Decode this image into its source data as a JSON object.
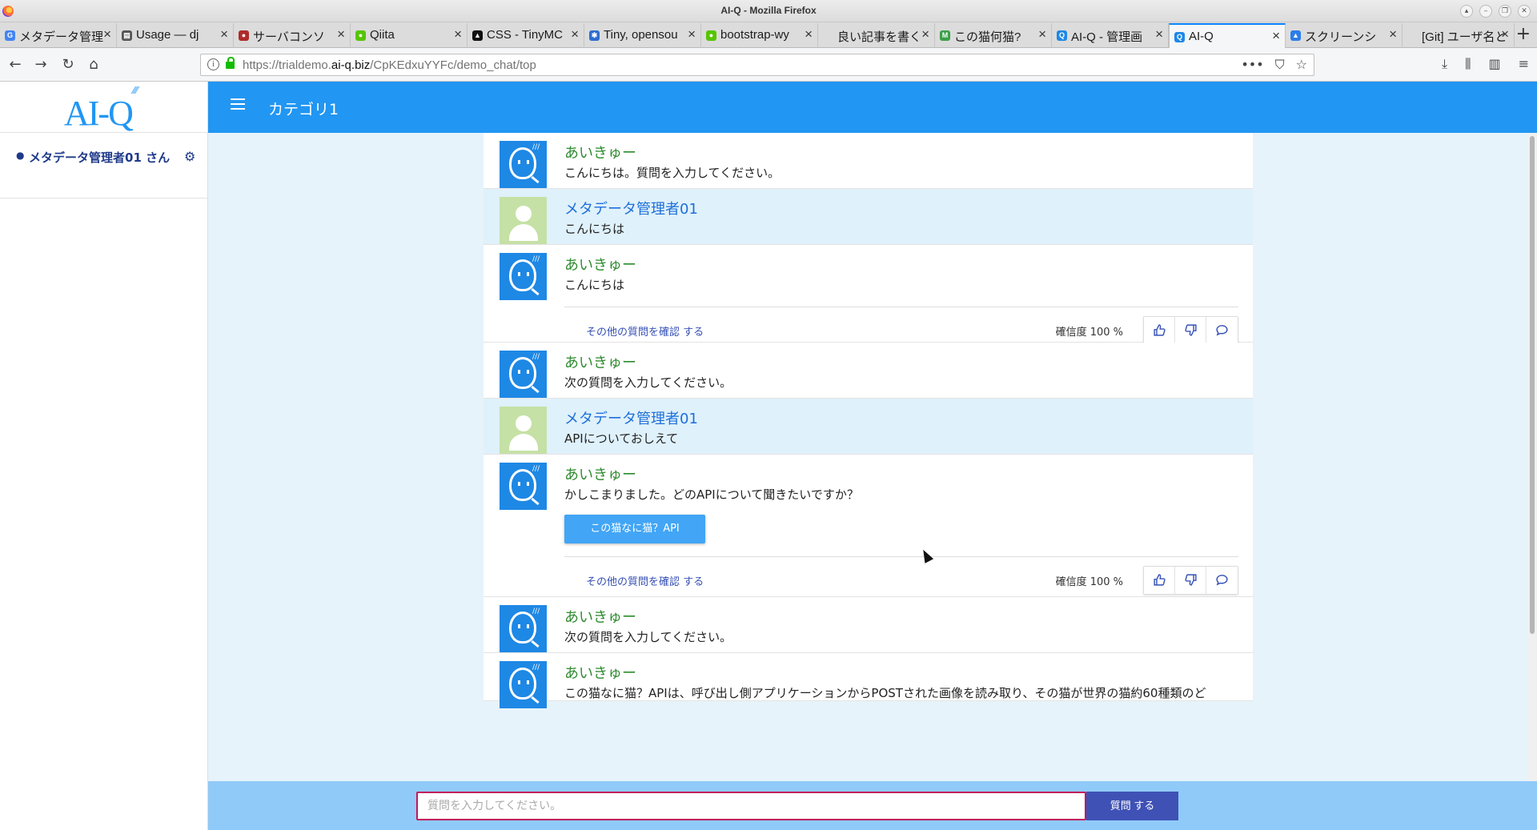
{
  "window": {
    "title": "AI-Q - Mozilla Firefox"
  },
  "tabs": [
    {
      "label": "メタデータ管理",
      "fav": "G",
      "color": "#4285f4"
    },
    {
      "label": "Usage — dj",
      "fav": "▤",
      "color": "#555555"
    },
    {
      "label": "サーバコンソ",
      "fav": "●",
      "color": "#b02a2a"
    },
    {
      "label": "Qiita",
      "fav": "●",
      "color": "#55c500"
    },
    {
      "label": "CSS - TinyMC",
      "fav": "▲",
      "color": "#111111"
    },
    {
      "label": "Tiny, opensou",
      "fav": "✱",
      "color": "#2f6dd0"
    },
    {
      "label": "bootstrap-wy",
      "fav": "●",
      "color": "#55c500"
    },
    {
      "label": "良い記事を書く",
      "fav": "",
      "color": "#dcdcdc"
    },
    {
      "label": "この猫何猫?",
      "fav": "M",
      "color": "#3aa047"
    },
    {
      "label": "AI-Q - 管理画",
      "fav": "Q",
      "color": "#1e88e5"
    },
    {
      "label": "AI-Q",
      "fav": "Q",
      "color": "#1e88e5",
      "active": true
    },
    {
      "label": "スクリーンシ",
      "fav": "▲",
      "color": "#2b7de9"
    },
    {
      "label": "[Git] ユーザ名と",
      "fav": "",
      "color": "#dcdcdc"
    }
  ],
  "nav": {
    "url_prefix": "https://trialdemo.",
    "url_domain": "ai-q.biz",
    "url_path": "/CpKEdxuYYFc/demo_chat/top"
  },
  "sidebar": {
    "logo": "AI-Q",
    "user_label": "メタデータ管理者01 さん"
  },
  "appbar": {
    "category": "カテゴリ1"
  },
  "messages": [
    {
      "role": "bot",
      "name": "あいきゅー",
      "text": "こんにちは。質問を入力してください。"
    },
    {
      "role": "user",
      "name": "メタデータ管理者01",
      "text": "こんにちは"
    },
    {
      "role": "bot",
      "name": "あいきゅー",
      "text": "こんにちは",
      "other": "その他の質問を確認 する",
      "confidence": "確信度 100 %"
    },
    {
      "role": "bot",
      "name": "あいきゅー",
      "text": "次の質問を入力してください。"
    },
    {
      "role": "user",
      "name": "メタデータ管理者01",
      "text": "APIについておしえて"
    },
    {
      "role": "bot",
      "name": "あいきゅー",
      "text": "かしこまりました。どのAPIについて聞きたいですか？",
      "choice": "この猫なに猫？API",
      "other": "その他の質問を確認 する",
      "confidence": "確信度 100 %"
    },
    {
      "role": "bot",
      "name": "あいきゅー",
      "text": "次の質問を入力してください。"
    },
    {
      "role": "bot",
      "name": "あいきゅー",
      "text": "この猫なに猫？APIは、呼び出し側アプリケーションからPOSTされた画像を読み取り、その猫が世界の猫約60種類のど"
    }
  ],
  "input": {
    "placeholder": "質問を入力してください。",
    "button": "質問 する"
  },
  "colors": {
    "primary": "#2196f3",
    "button": "#3f51b5",
    "botName": "#2e8b2e",
    "userName": "#1e6fd9"
  }
}
